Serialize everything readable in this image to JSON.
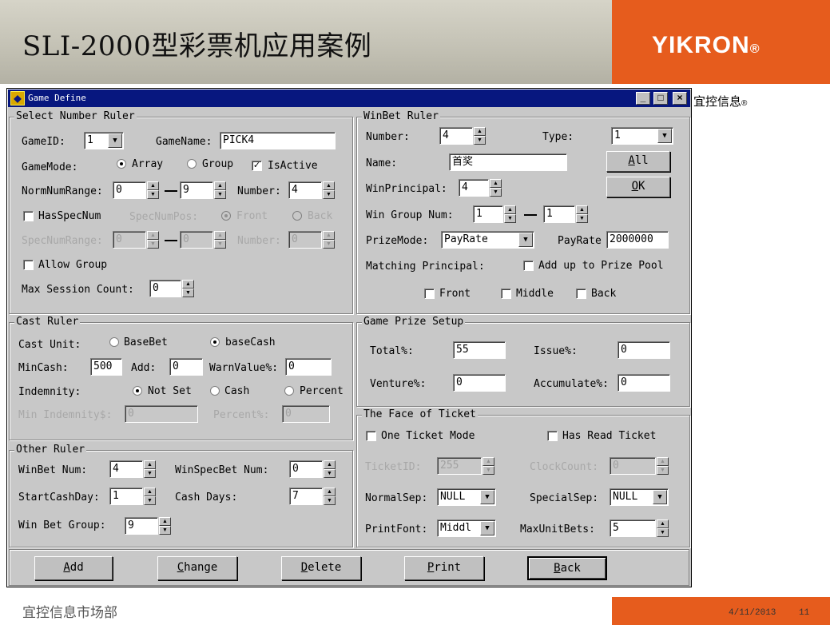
{
  "slide": {
    "title": "SLI-2000型彩票机应用案例",
    "brand": "YIKRON",
    "brand_reg": "®",
    "side_caption": "宜控信息",
    "side_caption_reg": "®",
    "footer_left": "宜控信息市场部",
    "date": "4/11/2013",
    "page": "11",
    "accent_color": "#e65c1d"
  },
  "window": {
    "title": "Game Define",
    "icon": "app-icon",
    "controls": {
      "minimize": "_",
      "maximize": "□",
      "close": "×"
    }
  },
  "select_number": {
    "group_label": "Select Number Ruler",
    "game_id_label": "GameID:",
    "game_id_value": "1",
    "game_name_label": "GameName:",
    "game_name_value": "PICK4",
    "game_mode_label": "GameMode:",
    "mode_array": "Array",
    "mode_group": "Group",
    "is_active_label": "IsActive",
    "norm_range_label": "NormNumRange:",
    "norm_from": "0",
    "norm_to": "9",
    "number_label": "Number:",
    "number_value": "4",
    "has_spec_label": "HasSpecNum",
    "spec_pos_label": "SpecNumPos:",
    "spec_front": "Front",
    "spec_back": "Back",
    "spec_range_label": "SpecNumRange:",
    "spec_from": "0",
    "spec_to": "0",
    "spec_number_label": "Number:",
    "spec_number_value": "0",
    "allow_group_label": "Allow Group",
    "max_session_label": "Max Session Count:",
    "max_session_value": "0"
  },
  "winbet": {
    "group_label": "WinBet Ruler",
    "number_label": "Number:",
    "number_value": "4",
    "type_label": "Type:",
    "type_value": "1",
    "name_label": "Name:",
    "name_value": "首奖",
    "all_button": "All",
    "all_hotkey": "A",
    "ok_button": "OK",
    "ok_hotkey": "O",
    "win_principal_label": "WinPrincipal:",
    "win_principal_value": "4",
    "win_group_label": "Win Group Num:",
    "win_group_from": "1",
    "win_group_to": "1",
    "prize_mode_label": "PrizeMode:",
    "prize_mode_value": "PayRate",
    "payrate_label": "PayRate",
    "payrate_value": "2000000",
    "matching_label": "Matching Principal:",
    "add_up_label": "Add up to Prize Pool",
    "front_label": "Front",
    "middle_label": "Middle",
    "back_label": "Back"
  },
  "cast": {
    "group_label": "Cast Ruler",
    "cast_unit_label": "Cast Unit:",
    "base_bet": "BaseBet",
    "base_cash": "baseCash",
    "min_cash_label": "MinCash:",
    "min_cash_value": "500",
    "add_label": "Add:",
    "add_value": "0",
    "warn_label": "WarnValue%:",
    "warn_value": "0",
    "indemnity_label": "Indemnity:",
    "not_set": "Not Set",
    "cash": "Cash",
    "percent": "Percent",
    "min_indemnity_label": "Min Indemnity$:",
    "min_indemnity_value": "0",
    "percent_label": "Percent%:",
    "percent_value": "0"
  },
  "prize_setup": {
    "group_label": "Game Prize Setup",
    "total_label": "Total%:",
    "total_value": "55",
    "issue_label": "Issue%:",
    "issue_value": "0",
    "venture_label": "Venture%:",
    "venture_value": "0",
    "accumulate_label": "Accumulate%:",
    "accumulate_value": "0"
  },
  "other": {
    "group_label": "Other Ruler",
    "winbet_num_label": "WinBet Num:",
    "winbet_num_value": "4",
    "winspec_label": "WinSpecBet Num:",
    "winspec_value": "0",
    "start_day_label": "StartCashDay:",
    "start_day_value": "1",
    "cash_days_label": "Cash Days:",
    "cash_days_value": "7",
    "win_bet_group_label": "Win Bet Group:",
    "win_bet_group_value": "9"
  },
  "ticket": {
    "group_label": "The Face of Ticket",
    "one_ticket_label": "One Ticket Mode",
    "has_read_label": "Has Read Ticket",
    "ticket_id_label": "TicketID:",
    "ticket_id_value": "255",
    "clock_count_label": "ClockCount:",
    "clock_count_value": "0",
    "normal_sep_label": "NormalSep:",
    "normal_sep_value": "NULL",
    "special_sep_label": "SpecialSep:",
    "special_sep_value": "NULL",
    "print_font_label": "PrintFont:",
    "print_font_value": "Middl",
    "max_unit_label": "MaxUnitBets:",
    "max_unit_value": "5"
  },
  "buttons": {
    "add": "dd",
    "add_hotkey": "A",
    "change": "hange",
    "change_hotkey": "C",
    "delete": "elete",
    "delete_hotkey": "D",
    "print": "rint",
    "print_hotkey": "P",
    "back": "ack",
    "back_hotkey": "B"
  }
}
